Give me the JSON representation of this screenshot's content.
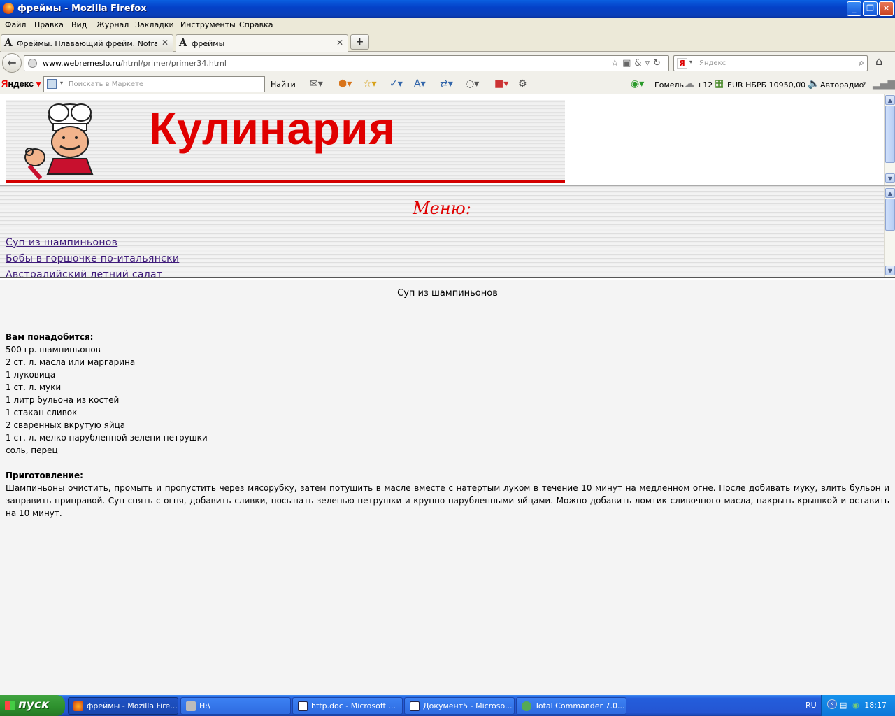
{
  "window": {
    "title": "фреймы - Mozilla Firefox"
  },
  "menu": [
    "Файл",
    "Правка",
    "Вид",
    "Журнал",
    "Закладки",
    "Инструменты",
    "Справка"
  ],
  "tabs": [
    {
      "label": "Фреймы. Плавающий фрейм. Noframes..."
    },
    {
      "label": "фреймы"
    }
  ],
  "nav": {
    "url_host": "www.webremeslo.ru",
    "url_path": "/html/primer/primer34.html",
    "search_placeholder": "Яндекс"
  },
  "yandex_bar": {
    "logo_y": "Я",
    "logo_rest": "ндекс",
    "market_placeholder": "Поискать в Маркете",
    "find_label": "Найти",
    "city": "Гомель",
    "temp": "+12",
    "currency": "EUR НБРБ 10950,00",
    "radio": "Авторадио"
  },
  "page": {
    "banner_title": "Кулинария",
    "menu_heading": "Меню:",
    "menu_links": [
      "Суп из шампиньонов",
      "Бобы в горшочке по-итальянски",
      "Австралийский летний салат"
    ],
    "recipe": {
      "title": "Суп из шампиньонов",
      "need_label": "Вам понадобится:",
      "ingredients": [
        "500 гр. шампиньонов",
        "2 ст. л. масла или маргарина",
        "1 луковица",
        "1 ст. л. муки",
        "1 литр бульона из костей",
        "1 стакан сливок",
        "2 сваренных вкрутую яйца",
        "1 ст. л. мелко нарубленной зелени петрушки",
        "соль, перец"
      ],
      "prep_label": "Приготовление:",
      "prep_text": "Шампиньоны очистить, промыть и пропустить через мясорубку, затем потушить в масле вместе с натертым луком в течение 10 минут на медленном огне. После добивать муку, влить бульон и заправить приправой. Суп снять с огня, добавить сливки, посыпать зеленью петрушки и крупно нарубленными яйцами. Можно добавить ломтик сливочного масла, накрыть крышкой и оставить на 10 минут."
    }
  },
  "taskbar": {
    "start": "пуск",
    "items": [
      "фреймы - Mozilla Fire...",
      "H:\\",
      "http.doc - Microsoft ...",
      "Документ5 - Microso...",
      "Total Commander 7.0..."
    ],
    "lang": "RU",
    "clock": "18:17"
  },
  "icons": [
    "firefox-icon",
    "minimize-icon",
    "maximize-icon",
    "close-icon",
    "back-icon",
    "globe-icon",
    "star-icon",
    "reload-icon",
    "search-icon",
    "home-icon",
    "gear-icon",
    "windows-flag-icon"
  ]
}
